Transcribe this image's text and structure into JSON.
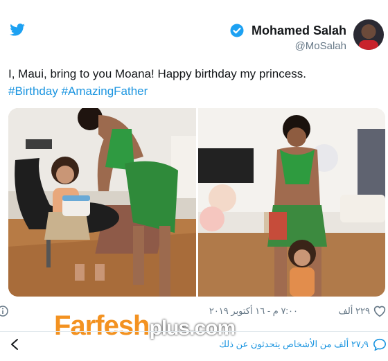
{
  "author": {
    "name": "Mohamed Salah",
    "handle": "@MoSalah"
  },
  "tweet": {
    "text": "I, Maui, bring to you Moana! Happy birthday my princess.",
    "hashtags": [
      "#Birthday",
      "#AmazingFather"
    ]
  },
  "photos": [
    {
      "description_icon": "photo"
    },
    {
      "description_icon": "photo"
    }
  ],
  "meta": {
    "likes": "٢٢٩ ألف",
    "date": "٧:٠٠ م - ١٦ أكتوبر ٢٠١٩",
    "people_talking": "٢٧٫٩ ألف من الأشخاص يتحدثون عن ذلك"
  },
  "watermark": {
    "part_a": "Farfesh",
    "part_b": "plus.com"
  },
  "colors": {
    "link": "#1b95e0",
    "muted": "#657786",
    "brand": "#1da1f2"
  }
}
